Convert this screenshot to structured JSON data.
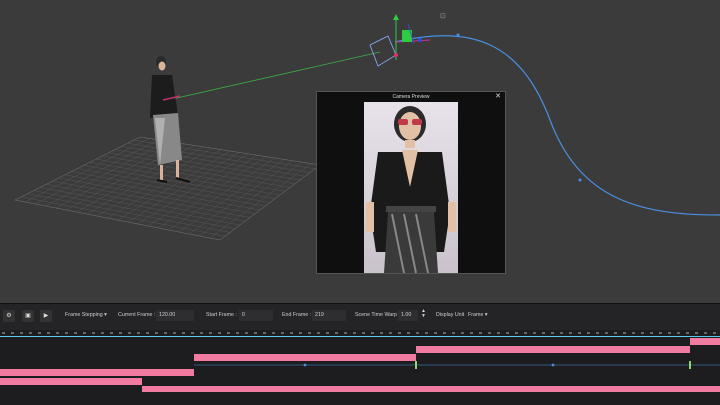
{
  "camera_preview": {
    "title": "Camera Preview",
    "close": "✕"
  },
  "toolbar": {
    "frame_stepping": "Frame Stepping ▾",
    "current_frame_label": "Current Frame :",
    "current_frame_value": "120.00",
    "start_frame_label": "Start Frame :",
    "start_frame_value": "0",
    "end_frame_label": "End Frame :",
    "end_frame_value": "219",
    "time_warp_label": "Scene Time Warp",
    "time_warp_value": "1.00",
    "display_unit_label": "Display Unit",
    "display_unit_value": "Frame ▾"
  },
  "colors": {
    "track": "#f07aa0",
    "path": "#4a8fe0",
    "ruler": "#5ac8e8"
  }
}
